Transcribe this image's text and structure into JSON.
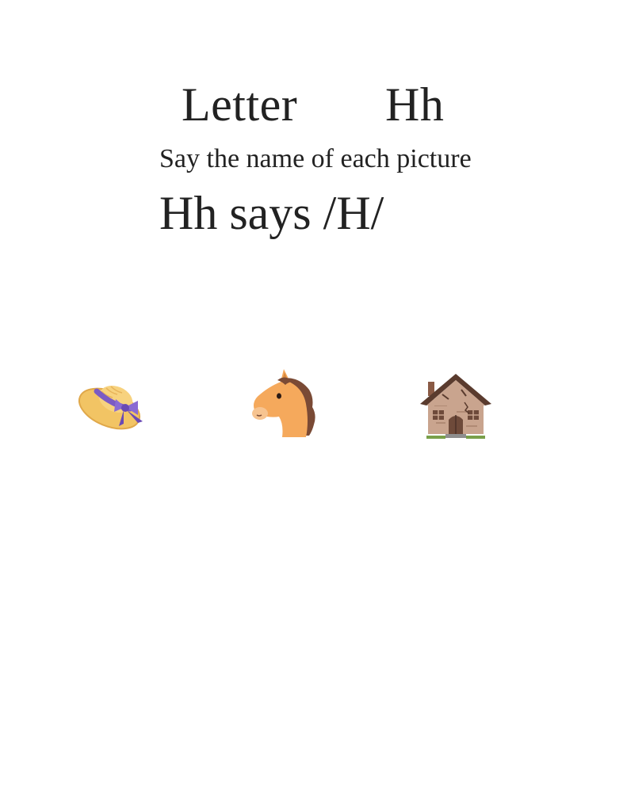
{
  "worksheet": {
    "title_word": "Letter",
    "title_letter": "Hh",
    "instruction": "Say the name of each picture",
    "sound_line": "Hh says /H/"
  },
  "pictures": [
    {
      "icon": "hat-icon"
    },
    {
      "icon": "horse-icon"
    },
    {
      "icon": "house-icon"
    }
  ],
  "colors": {
    "text": "#222222",
    "hat_straw": "#f2c464",
    "hat_ribbon": "#7b5bc4",
    "horse_body": "#f5a95c",
    "horse_mane": "#7a4a35",
    "house_wall": "#c9a48e",
    "house_roof": "#5a3b2e"
  }
}
